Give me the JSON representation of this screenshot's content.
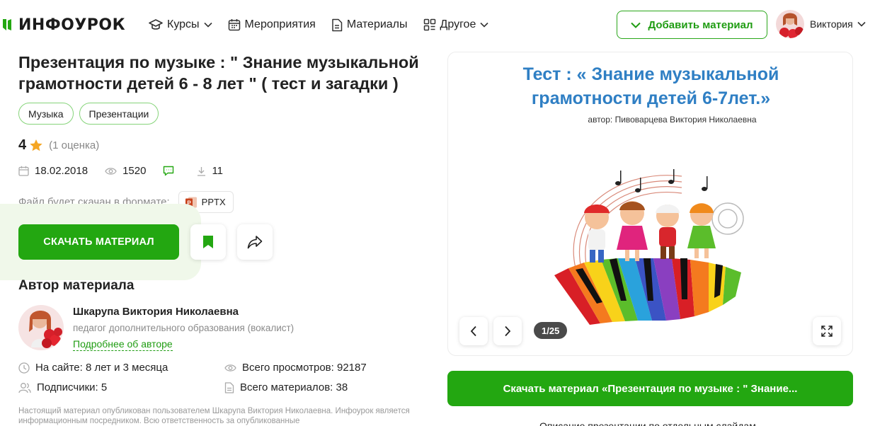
{
  "header": {
    "logo_text": "ИНФОУРОК",
    "nav": [
      {
        "label": "Курсы",
        "icon": "graduation-cap-icon",
        "has_dropdown": true
      },
      {
        "label": "Мероприятия",
        "icon": "calendar-icon",
        "has_dropdown": false
      },
      {
        "label": "Материалы",
        "icon": "document-icon",
        "has_dropdown": false
      },
      {
        "label": "Другое",
        "icon": "grid-icon",
        "has_dropdown": true
      }
    ],
    "add_button": "Добавить материал",
    "user_name": "Виктория"
  },
  "material": {
    "title": "Презентация по музыке : \" Знание музыкальной грамотности детей 6 - 8 лет \" ( тест и загадки )",
    "tags": [
      "Музыка",
      "Презентации"
    ],
    "rating": "4",
    "rating_count": "(1 оценка)",
    "date": "18.02.2018",
    "views": "1520",
    "downloads": "11",
    "format_label": "Файл будет скачан в формате:",
    "format": "PPTX",
    "download_button": "СКАЧАТЬ МАТЕРИАЛ"
  },
  "author": {
    "heading": "Автор материала",
    "name": "Шкарупа Виктория Николаевна",
    "role": "педагог дополнительного образования (вокалист)",
    "link": "Подробнее об авторе",
    "on_site": "На сайте: 8 лет и 3 месяца",
    "subscribers": "Подписчики: 5",
    "total_views": "Всего просмотров: 92187",
    "total_materials": "Всего материалов: 38"
  },
  "disclaimer": "Настоящий материал опубликован пользователем Шкарупа Виктория Николаевна. Инфоурок является информационным посредником. Всю ответственность за опубликованные",
  "preview": {
    "slide_title_line1": "Тест : « Знание музыкальной",
    "slide_title_line2": "грамотности детей 6-7лет.»",
    "slide_author": "автор: Пивоварцева Виктория Николаевна",
    "page_indicator": "1/25",
    "download_wide": "Скачать материал «Презентация по музыке : \" Знание...",
    "bottom_link": "Описание презентации по отдельным слайдам"
  },
  "colors": {
    "accent_green": "#23a711",
    "slide_title_blue": "#2f7fc4",
    "star": "#f5a623"
  }
}
